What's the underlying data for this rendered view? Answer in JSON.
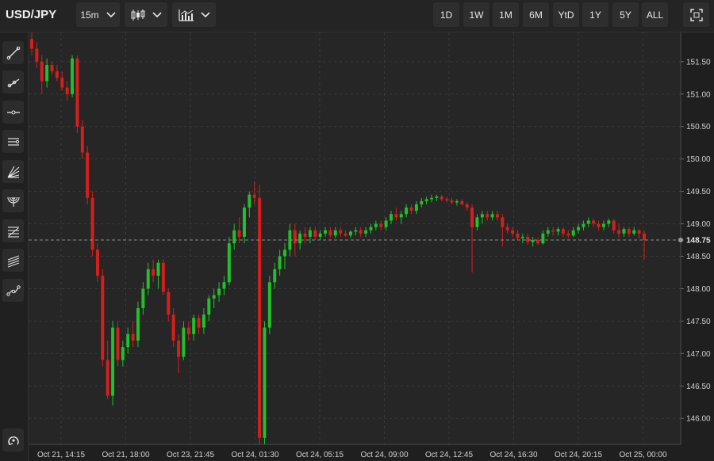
{
  "header": {
    "symbol": "USD/JPY",
    "interval": "15m",
    "chart_type_icon": "candlestick-icon",
    "indicators_icon": "indicators-icon",
    "ranges": [
      "1D",
      "1W",
      "1M",
      "6M",
      "YtD",
      "1Y",
      "5Y",
      "ALL"
    ],
    "fullscreen_icon": "fullscreen-icon"
  },
  "tools": [
    {
      "name": "trend-line-tool",
      "icon": "trend-line-icon"
    },
    {
      "name": "ray-tool",
      "icon": "ray-icon"
    },
    {
      "name": "horizontal-line-tool",
      "icon": "horizontal-line-icon"
    },
    {
      "name": "channel-tool",
      "icon": "channel-icon"
    },
    {
      "name": "fan-tool",
      "icon": "fan-icon"
    },
    {
      "name": "arc-tool",
      "icon": "arc-icon"
    },
    {
      "name": "fibonacci-tool",
      "icon": "fibonacci-icon"
    },
    {
      "name": "parallel-lines-tool",
      "icon": "parallel-lines-icon"
    },
    {
      "name": "path-tool",
      "icon": "path-icon"
    },
    {
      "name": "reset-tool",
      "icon": "reset-icon"
    }
  ],
  "chart_data": {
    "type": "candlestick",
    "symbol": "USD/JPY",
    "interval": "15m",
    "ylim": [
      145.6,
      151.95
    ],
    "yticks": [
      "146.00",
      "146.50",
      "147.00",
      "147.50",
      "148.00",
      "148.50",
      "148.75",
      "149.00",
      "149.50",
      "150.00",
      "150.50",
      "151.00",
      "151.50"
    ],
    "xticks": [
      "Oct 21, 14:15",
      "Oct 21, 18:00",
      "Oct 23, 21:45",
      "Oct 24, 01:30",
      "Oct 24, 05:15",
      "Oct 24, 09:00",
      "Oct 24, 12:45",
      "Oct 24, 16:30",
      "Oct 24, 20:15",
      "Oct 25, 00:00"
    ],
    "last_price": "148.75",
    "grid": true,
    "up_color": "#22c02a",
    "down_color": "#d4201c",
    "candles": [
      [
        151.85,
        151.95,
        151.6,
        151.7
      ],
      [
        151.7,
        151.8,
        151.4,
        151.5
      ],
      [
        151.5,
        151.6,
        151.0,
        151.2
      ],
      [
        151.2,
        151.55,
        151.1,
        151.45
      ],
      [
        151.45,
        151.5,
        151.3,
        151.35
      ],
      [
        151.35,
        151.45,
        151.2,
        151.25
      ],
      [
        151.25,
        151.35,
        151.05,
        151.1
      ],
      [
        151.1,
        151.2,
        150.9,
        151.0
      ],
      [
        151.0,
        151.6,
        150.95,
        151.55
      ],
      [
        151.55,
        151.6,
        150.4,
        150.5
      ],
      [
        150.5,
        150.6,
        150.0,
        150.1
      ],
      [
        150.1,
        150.2,
        149.3,
        149.4
      ],
      [
        149.4,
        149.5,
        148.5,
        148.6
      ],
      [
        148.6,
        148.7,
        148.1,
        148.2
      ],
      [
        148.2,
        148.3,
        146.8,
        146.9
      ],
      [
        146.9,
        147.2,
        146.3,
        146.35
      ],
      [
        146.35,
        147.5,
        146.2,
        147.4
      ],
      [
        147.4,
        147.5,
        146.8,
        146.9
      ],
      [
        146.9,
        147.2,
        146.8,
        147.1
      ],
      [
        147.1,
        147.4,
        147.0,
        147.3
      ],
      [
        147.3,
        147.5,
        147.1,
        147.2
      ],
      [
        147.2,
        147.8,
        147.1,
        147.7
      ],
      [
        147.7,
        148.1,
        147.6,
        148.0
      ],
      [
        148.0,
        148.4,
        147.9,
        148.3
      ],
      [
        148.3,
        148.45,
        148.1,
        148.2
      ],
      [
        148.2,
        148.45,
        148.0,
        148.4
      ],
      [
        148.4,
        148.45,
        147.9,
        147.95
      ],
      [
        147.95,
        148.0,
        147.5,
        147.6
      ],
      [
        147.6,
        147.7,
        147.1,
        147.2
      ],
      [
        147.2,
        147.3,
        146.7,
        146.95
      ],
      [
        146.95,
        147.5,
        146.9,
        147.4
      ],
      [
        147.4,
        147.5,
        147.2,
        147.3
      ],
      [
        147.3,
        147.6,
        147.2,
        147.55
      ],
      [
        147.55,
        147.6,
        147.3,
        147.4
      ],
      [
        147.4,
        147.7,
        147.3,
        147.6
      ],
      [
        147.6,
        147.9,
        147.5,
        147.85
      ],
      [
        147.85,
        148.0,
        147.7,
        147.9
      ],
      [
        147.9,
        148.1,
        147.8,
        148.0
      ],
      [
        148.0,
        148.2,
        147.9,
        148.1
      ],
      [
        148.1,
        148.8,
        148.05,
        148.7
      ],
      [
        148.7,
        149.0,
        148.6,
        148.9
      ],
      [
        148.9,
        149.1,
        148.7,
        148.8
      ],
      [
        148.8,
        149.3,
        148.7,
        149.25
      ],
      [
        149.25,
        149.5,
        149.1,
        149.45
      ],
      [
        149.45,
        149.65,
        149.3,
        149.4
      ],
      [
        149.4,
        149.6,
        145.6,
        145.7
      ],
      [
        145.7,
        147.5,
        145.6,
        147.4
      ],
      [
        147.4,
        148.2,
        147.3,
        148.1
      ],
      [
        148.1,
        148.4,
        148.0,
        148.3
      ],
      [
        148.3,
        148.6,
        148.2,
        148.5
      ],
      [
        148.5,
        148.7,
        148.3,
        148.6
      ],
      [
        148.6,
        149.0,
        148.5,
        148.9
      ],
      [
        148.9,
        149.0,
        148.5,
        148.7
      ],
      [
        148.7,
        148.9,
        148.6,
        148.85
      ],
      [
        148.85,
        148.95,
        148.7,
        148.8
      ],
      [
        148.8,
        148.95,
        148.7,
        148.9
      ],
      [
        148.9,
        148.95,
        148.75,
        148.8
      ],
      [
        148.8,
        148.9,
        148.75,
        148.85
      ],
      [
        148.85,
        148.95,
        148.8,
        148.9
      ],
      [
        148.9,
        148.95,
        148.78,
        148.82
      ],
      [
        148.82,
        148.95,
        148.78,
        148.9
      ],
      [
        148.9,
        148.95,
        148.8,
        148.85
      ],
      [
        148.85,
        148.9,
        148.8,
        148.82
      ],
      [
        148.82,
        148.9,
        148.78,
        148.88
      ],
      [
        148.88,
        148.95,
        148.82,
        148.9
      ],
      [
        148.9,
        148.95,
        148.8,
        148.85
      ],
      [
        148.85,
        148.95,
        148.8,
        148.9
      ],
      [
        148.9,
        149.0,
        148.85,
        148.95
      ],
      [
        148.95,
        149.05,
        148.9,
        149.0
      ],
      [
        149.0,
        149.05,
        148.9,
        148.95
      ],
      [
        148.95,
        149.1,
        148.9,
        149.05
      ],
      [
        149.05,
        149.2,
        149.0,
        149.15
      ],
      [
        149.15,
        149.25,
        149.05,
        149.1
      ],
      [
        149.1,
        149.2,
        149.0,
        149.15
      ],
      [
        149.15,
        149.3,
        149.1,
        149.25
      ],
      [
        149.25,
        149.3,
        149.15,
        149.2
      ],
      [
        149.2,
        149.35,
        149.15,
        149.3
      ],
      [
        149.3,
        149.4,
        149.25,
        149.35
      ],
      [
        149.35,
        149.42,
        149.3,
        149.38
      ],
      [
        149.38,
        149.45,
        149.33,
        149.4
      ],
      [
        149.4,
        149.45,
        149.35,
        149.42
      ],
      [
        149.42,
        149.45,
        149.35,
        149.38
      ],
      [
        149.38,
        149.42,
        149.33,
        149.36
      ],
      [
        149.36,
        149.4,
        149.3,
        149.33
      ],
      [
        149.33,
        149.38,
        149.28,
        149.35
      ],
      [
        149.35,
        149.38,
        149.28,
        149.3
      ],
      [
        149.3,
        149.33,
        149.2,
        149.25
      ],
      [
        149.25,
        149.3,
        148.25,
        148.95
      ],
      [
        148.95,
        149.15,
        148.9,
        149.1
      ],
      [
        149.1,
        149.2,
        149.0,
        149.15
      ],
      [
        149.15,
        149.2,
        149.05,
        149.1
      ],
      [
        149.1,
        149.2,
        149.05,
        149.15
      ],
      [
        149.15,
        149.2,
        149.05,
        149.1
      ],
      [
        149.1,
        149.15,
        148.65,
        148.95
      ],
      [
        148.95,
        149.0,
        148.85,
        148.9
      ],
      [
        148.9,
        148.95,
        148.8,
        148.85
      ],
      [
        148.85,
        148.9,
        148.75,
        148.78
      ],
      [
        148.78,
        148.85,
        148.7,
        148.8
      ],
      [
        148.8,
        148.85,
        148.68,
        148.72
      ],
      [
        148.72,
        148.8,
        148.65,
        148.75
      ],
      [
        148.75,
        148.78,
        148.68,
        148.7
      ],
      [
        148.7,
        148.9,
        148.68,
        148.85
      ],
      [
        148.85,
        148.95,
        148.8,
        148.9
      ],
      [
        148.9,
        148.95,
        148.82,
        148.88
      ],
      [
        148.88,
        148.95,
        148.82,
        148.92
      ],
      [
        148.92,
        148.95,
        148.8,
        148.85
      ],
      [
        148.85,
        148.9,
        148.78,
        148.82
      ],
      [
        148.82,
        148.95,
        148.8,
        148.9
      ],
      [
        148.9,
        149.0,
        148.85,
        148.95
      ],
      [
        148.95,
        149.05,
        148.9,
        149.0
      ],
      [
        149.0,
        149.1,
        148.95,
        149.05
      ],
      [
        149.05,
        149.08,
        148.95,
        149.0
      ],
      [
        149.0,
        149.05,
        148.9,
        148.95
      ],
      [
        148.95,
        149.05,
        148.9,
        149.0
      ],
      [
        149.0,
        149.08,
        148.95,
        149.05
      ],
      [
        149.05,
        149.08,
        148.85,
        148.9
      ],
      [
        148.9,
        149.0,
        148.78,
        148.85
      ],
      [
        148.85,
        148.95,
        148.8,
        148.92
      ],
      [
        148.92,
        148.95,
        148.8,
        148.85
      ],
      [
        148.85,
        148.95,
        148.82,
        148.9
      ],
      [
        148.9,
        148.92,
        148.78,
        148.85
      ],
      [
        148.85,
        148.9,
        148.45,
        148.75
      ]
    ]
  }
}
